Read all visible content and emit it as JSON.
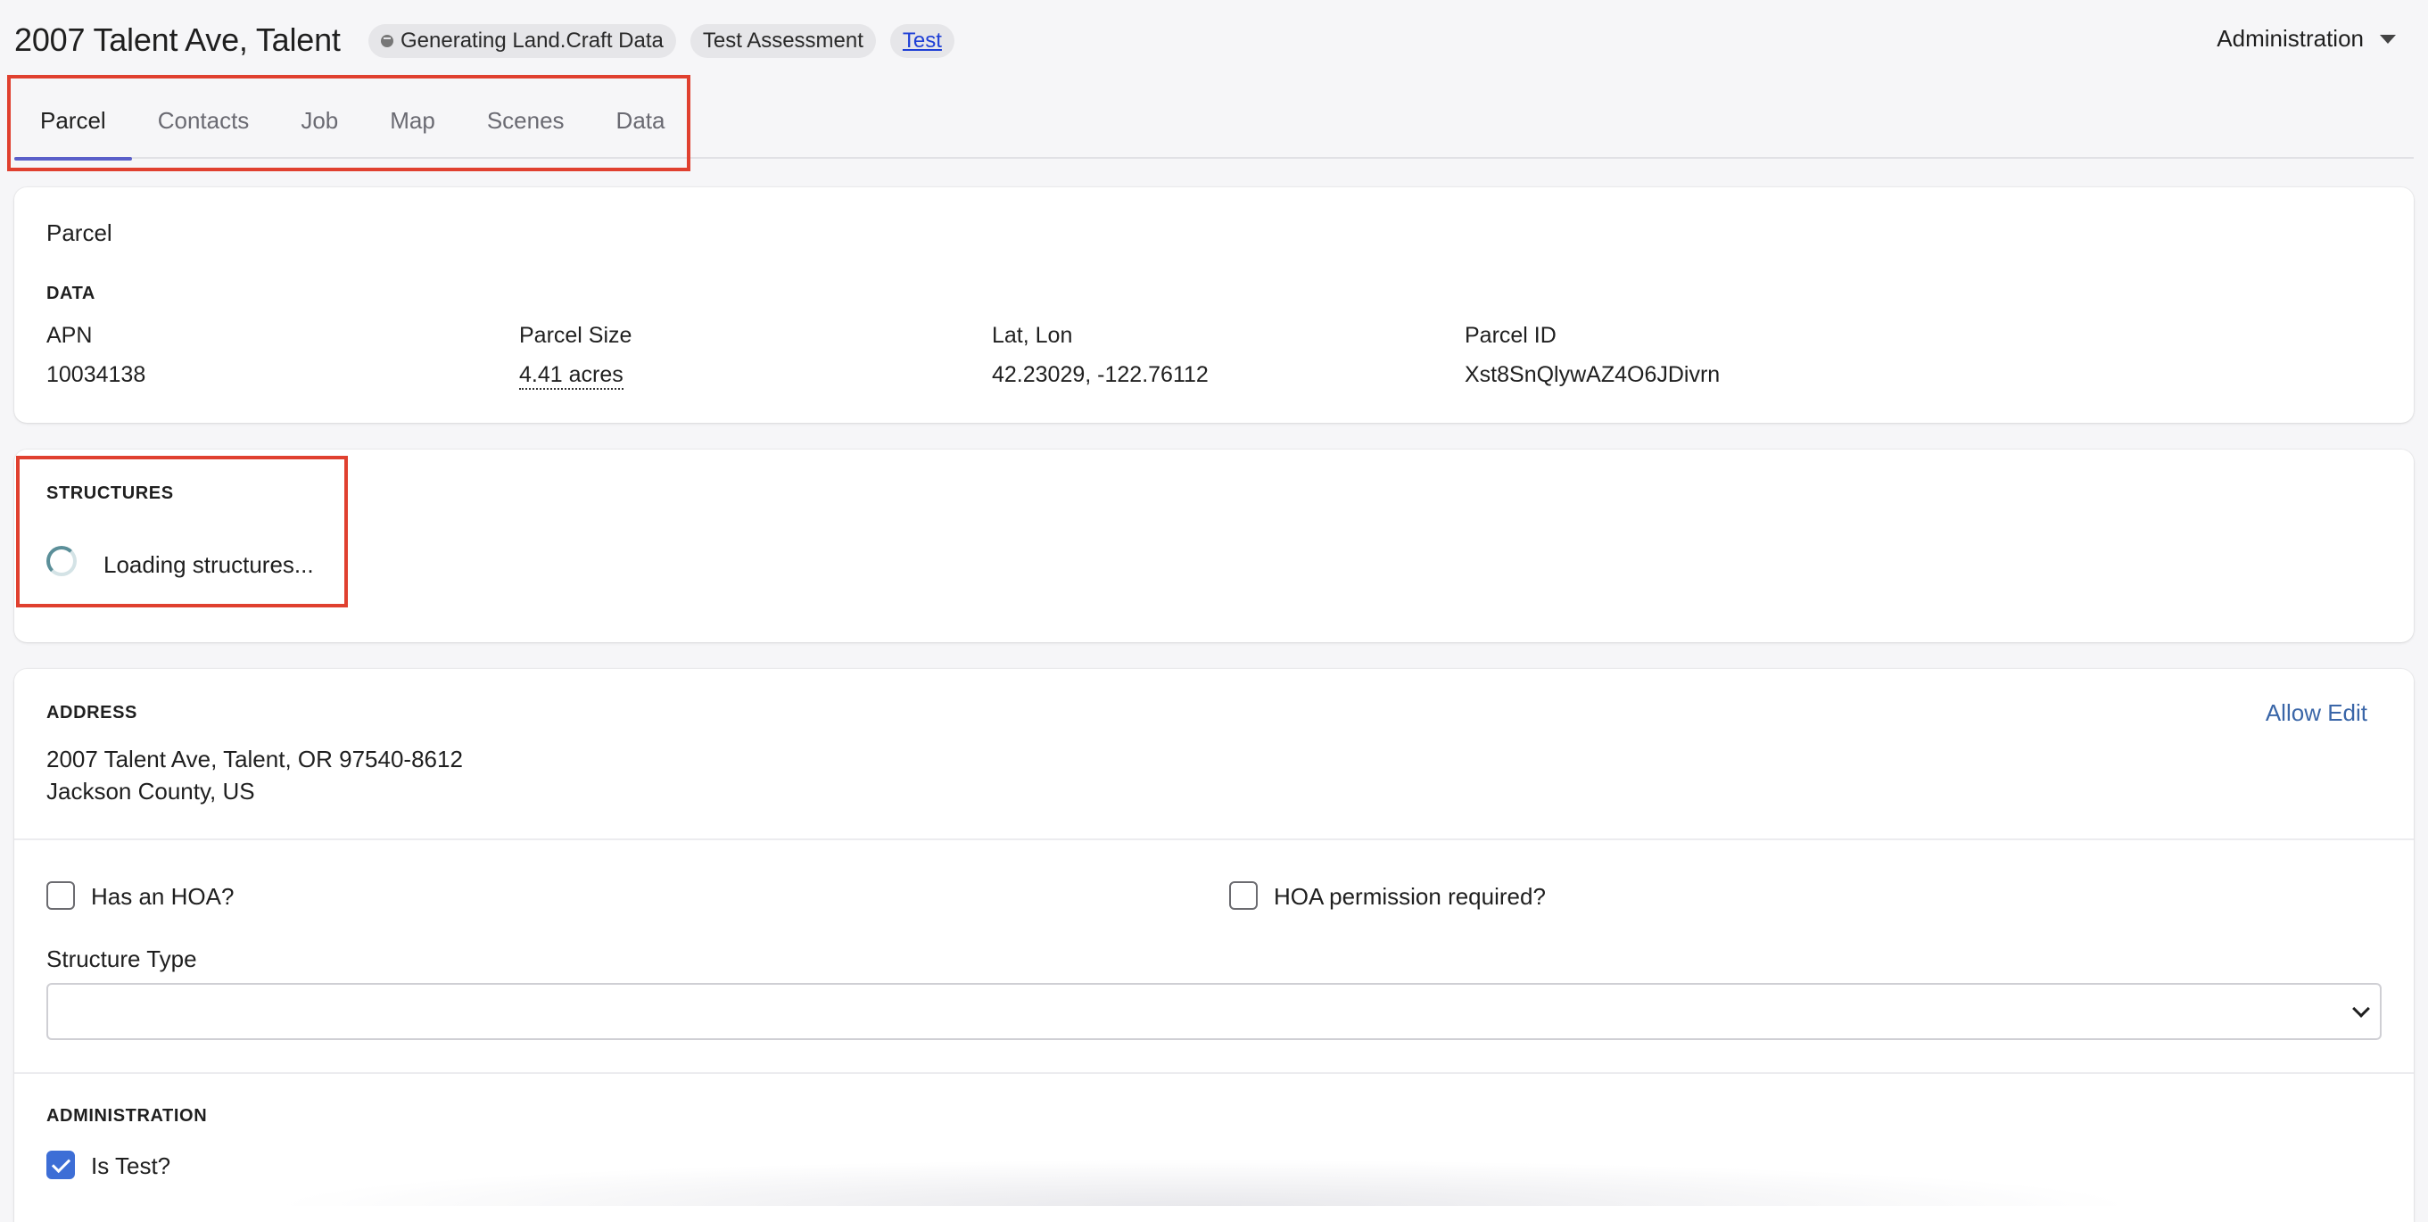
{
  "header": {
    "title": "2007 Talent Ave, Talent",
    "badges": {
      "status": "Generating Land.Craft Data",
      "assessment": "Test Assessment",
      "test_link": "Test"
    },
    "admin_menu_label": "Administration"
  },
  "tabs": [
    {
      "label": "Parcel",
      "active": true
    },
    {
      "label": "Contacts",
      "active": false
    },
    {
      "label": "Job",
      "active": false
    },
    {
      "label": "Map",
      "active": false
    },
    {
      "label": "Scenes",
      "active": false
    },
    {
      "label": "Data",
      "active": false
    }
  ],
  "parcel": {
    "title": "Parcel",
    "data_label": "DATA",
    "fields": [
      {
        "label": "APN",
        "value": "10034138"
      },
      {
        "label": "Parcel Size",
        "value": "4.41 acres"
      },
      {
        "label": "Lat, Lon",
        "value": "42.23029, -122.76112"
      },
      {
        "label": "Parcel ID",
        "value": "Xst8SnQlywAZ4O6JDivrn"
      }
    ]
  },
  "structures": {
    "label": "STRUCTURES",
    "loading_text": "Loading structures..."
  },
  "address": {
    "label": "ADDRESS",
    "edit_link": "Allow Edit",
    "line1": "2007 Talent Ave, Talent, OR 97540-8612",
    "line2": "Jackson County, US",
    "has_hoa_label": "Has an HOA?",
    "has_hoa_checked": false,
    "hoa_permission_label": "HOA permission required?",
    "hoa_permission_checked": false,
    "structure_type_label": "Structure Type",
    "structure_type_value": ""
  },
  "administration": {
    "label": "ADMINISTRATION",
    "is_test_label": "Is Test?",
    "is_test_checked": true
  },
  "colors": {
    "accent": "#5a5fc9",
    "highlight": "#e0402f",
    "link": "#3a66a8",
    "checkbox_checked": "#3d6ed6"
  }
}
